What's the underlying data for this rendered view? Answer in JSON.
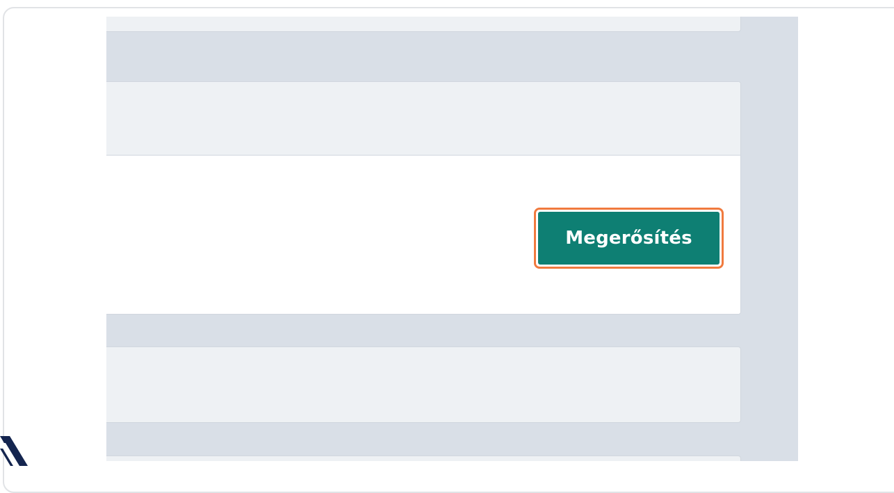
{
  "confirm_button": {
    "label": "Megerősítés"
  },
  "colors": {
    "accent": "#0e7f73",
    "highlight": "#f07a3e",
    "page_background": "#d9dfe7",
    "panel_background": "#eef1f4"
  },
  "corner_logo": {
    "icon": "brand-logo-icon"
  }
}
